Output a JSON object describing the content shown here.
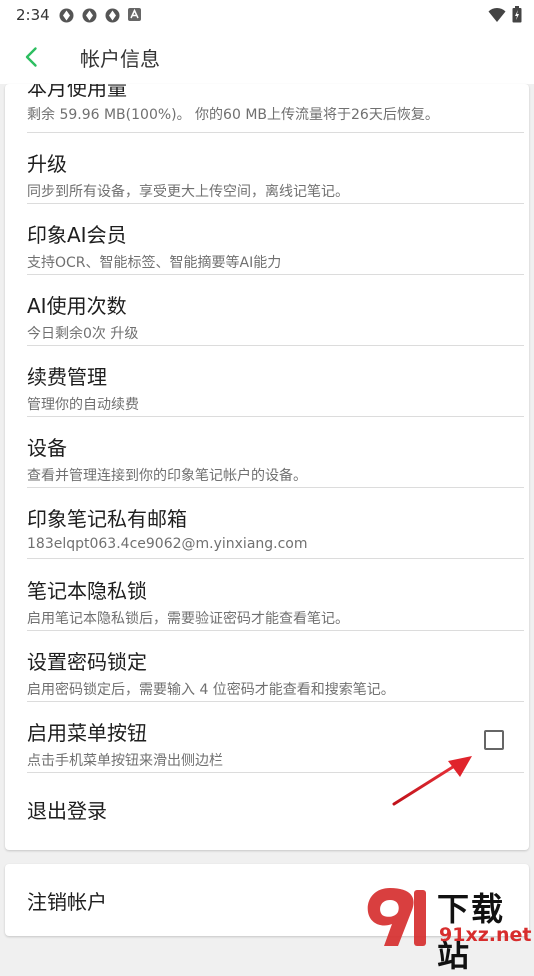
{
  "status_bar": {
    "time": "2:34",
    "icons": [
      "sync-icon",
      "sync-icon",
      "sync-icon",
      "a-badge-icon"
    ],
    "right_icons": [
      "wifi-icon",
      "battery-icon"
    ]
  },
  "app_bar": {
    "back_icon": "chevron-left-icon",
    "title": "帐户信息",
    "accent": "#2dbe60"
  },
  "settings": [
    {
      "title": "本月使用量",
      "subtitle": "剩余 59.96 MB(100%)。 你的60 MB上传流量将于26天后恢复。"
    },
    {
      "title": "升级",
      "subtitle": "同步到所有设备，享受更大上传空间，离线记笔记。"
    },
    {
      "title": "印象AI会员",
      "subtitle": "支持OCR、智能标签、智能摘要等AI能力"
    },
    {
      "title": "AI使用次数",
      "subtitle": "今日剩余0次 升级"
    },
    {
      "title": "续费管理",
      "subtitle": "管理你的自动续费"
    },
    {
      "title": "设备",
      "subtitle": "查看并管理连接到你的印象笔记帐户的设备。"
    },
    {
      "title": "印象笔记私有邮箱",
      "subtitle": "183elqpt063.4ce9062@m.yinxiang.com"
    },
    {
      "title": "笔记本隐私锁",
      "subtitle": "启用笔记本隐私锁后，需要验证密码才能查看笔记。"
    },
    {
      "title": "设置密码锁定",
      "subtitle": "启用密码锁定后，需要输入 4 位密码才能查看和搜索笔记。"
    },
    {
      "title": "启用菜单按钮",
      "subtitle": "点击手机菜单按钮来滑出侧边栏",
      "checked": false
    },
    {
      "title": "退出登录"
    }
  ],
  "footer": {
    "cancel_account": "注销帐户"
  },
  "watermark": {
    "top": "下载站",
    "bottom": "91xz.net"
  }
}
